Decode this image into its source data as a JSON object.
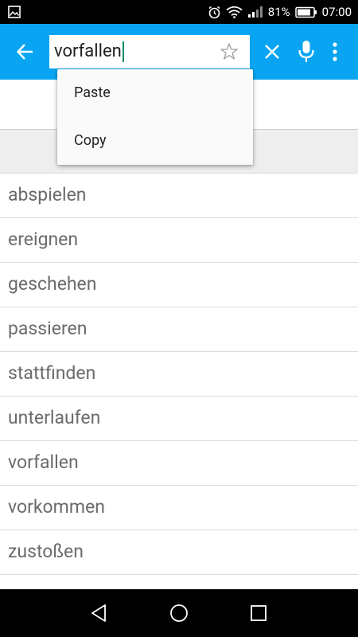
{
  "status_bar": {
    "battery": "81%",
    "time": "07:00",
    "icons": [
      "gallery-icon",
      "alarm-icon",
      "wifi-icon",
      "signal-icon",
      "battery-icon"
    ]
  },
  "search": {
    "value": "vorfallen",
    "icons": [
      "back-arrow-icon",
      "star-outline-icon",
      "close-icon",
      "microphone-icon",
      "more-vert-icon"
    ]
  },
  "context_menu": {
    "items": [
      {
        "label": "Paste"
      },
      {
        "label": "Copy"
      }
    ]
  },
  "results": [
    {
      "word": "abspielen"
    },
    {
      "word": "ereignen"
    },
    {
      "word": "geschehen"
    },
    {
      "word": "passieren"
    },
    {
      "word": "stattfinden"
    },
    {
      "word": "unterlaufen"
    },
    {
      "word": "vorfallen"
    },
    {
      "word": "vorkommen"
    },
    {
      "word": "zustoßen"
    }
  ],
  "nav_bar": {
    "icons": [
      "nav-back-icon",
      "nav-home-icon",
      "nav-recents-icon"
    ]
  },
  "colors": {
    "app_bar": "#0aa5f2",
    "cursor": "#0e8a6e",
    "result_text": "#6b6b6b",
    "grey_band": "#eeeeee"
  }
}
